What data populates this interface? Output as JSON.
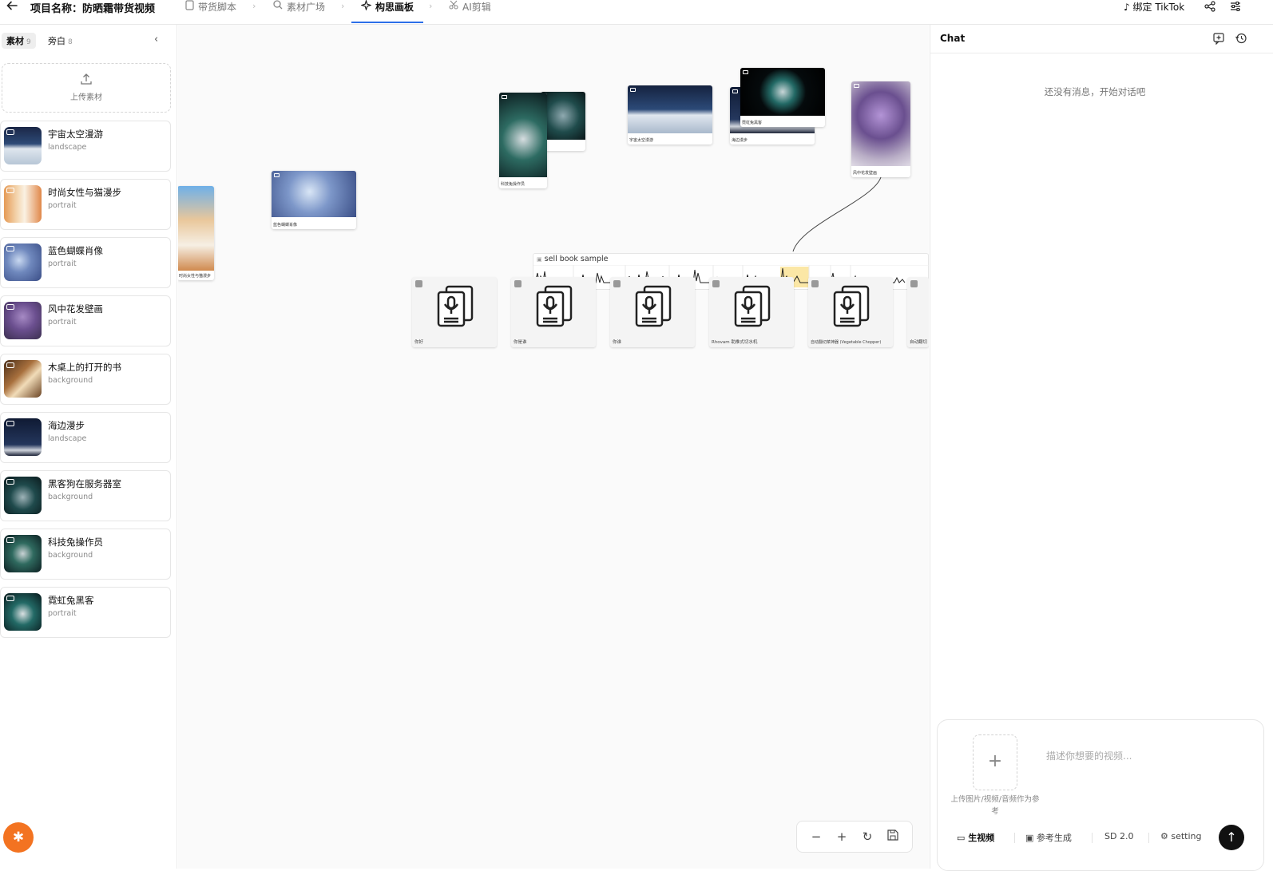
{
  "header": {
    "project_title": "项目名称：防晒霜带货视频",
    "tabs": [
      {
        "label": "带货脚本"
      },
      {
        "label": "素材广场"
      },
      {
        "label": "构思画板"
      },
      {
        "label": "AI剪辑"
      }
    ],
    "bind_tiktok": "绑定 TikTok"
  },
  "sidebar": {
    "tabs": [
      {
        "label": "素材",
        "count": "9"
      },
      {
        "label": "旁白",
        "count": "8"
      }
    ],
    "upload_label": "上传素材",
    "assets": [
      {
        "name": "宇宙太空漫游",
        "kind": "landscape",
        "type": "video"
      },
      {
        "name": "时尚女性与猫漫步",
        "kind": "portrait",
        "type": "video"
      },
      {
        "name": "蓝色蝴蝶肖像",
        "kind": "portrait",
        "type": "video"
      },
      {
        "name": "风中花发壁画",
        "kind": "portrait",
        "type": "video"
      },
      {
        "name": "木桌上的打开的书",
        "kind": "background",
        "type": "image"
      },
      {
        "name": "海边漫步",
        "kind": "landscape",
        "type": "video"
      },
      {
        "name": "黑客狗在服务器室",
        "kind": "background",
        "type": "image"
      },
      {
        "name": "科技兔操作员",
        "kind": "background",
        "type": "image"
      },
      {
        "name": "霓虹兔黑客",
        "kind": "portrait",
        "type": "video"
      }
    ]
  },
  "canvas": {
    "nodes": [
      {
        "caption": "时尚女性与猫漫步"
      },
      {
        "caption": "蓝色蝴蝶肖像"
      },
      {
        "caption": "科技兔操作员"
      },
      {
        "caption": "宇宙太空漫游"
      },
      {
        "caption": "海边漫步"
      },
      {
        "caption": "霓虹兔黑客"
      },
      {
        "caption": "风中花发壁画"
      }
    ],
    "track_label": "sell book sample",
    "audio_nodes": [
      {
        "caption": "你好"
      },
      {
        "caption": "你是谁"
      },
      {
        "caption": "你谁"
      },
      {
        "caption": "Rhovam 助推式切水机"
      },
      {
        "caption": "自动翻切菜神器 (Vegetable Chopper)"
      },
      {
        "caption": "自动翻切"
      }
    ]
  },
  "chat": {
    "title": "Chat",
    "empty_message": "还没有消息，开始对话吧",
    "ref_upload_label": "上传图片/视频/音频作为参考",
    "prompt_placeholder": "描述你想要的视频...",
    "modes": [
      {
        "label": "生视频"
      },
      {
        "label": "参考生成"
      },
      {
        "label": "SD 2.0"
      },
      {
        "label": "setting"
      }
    ]
  },
  "colors": {
    "accent": "#2c6fe8",
    "bug_button": "#f37321",
    "send_button": "#111111"
  }
}
